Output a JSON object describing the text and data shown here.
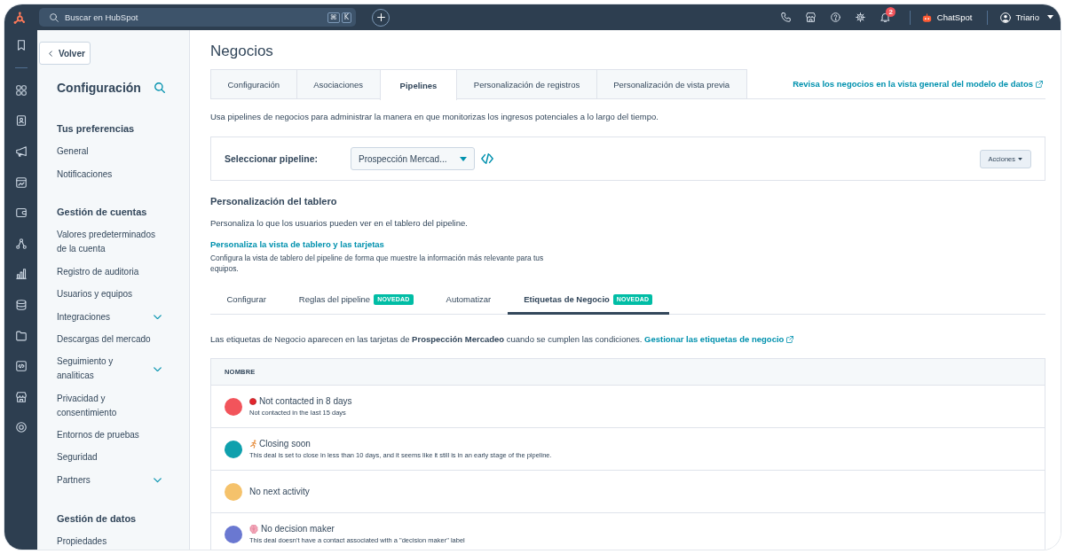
{
  "top_bar": {
    "search": {
      "placeholder": "Buscar en HubSpot",
      "shortcut": [
        "⌘",
        "K"
      ]
    },
    "notifications": {
      "count": "2"
    },
    "assistant": {
      "label": "ChatSpot"
    },
    "account": {
      "name": "Triario"
    }
  },
  "sidebar": {
    "back_button": "Volver",
    "title": "Configuración",
    "sections": [
      {
        "heading": "Tus preferencias",
        "items": [
          {
            "label": "General",
            "kind": "link"
          },
          {
            "label": "Notificaciones",
            "kind": "link"
          }
        ]
      },
      {
        "heading": "Gestión de cuentas",
        "items": [
          {
            "label": "Valores predeterminados de la cuenta",
            "kind": "link"
          },
          {
            "label": "Registro de auditoria",
            "kind": "link"
          },
          {
            "label": "Usuarios y equipos",
            "kind": "link"
          },
          {
            "label": "Integraciones",
            "kind": "group",
            "expanded": false
          },
          {
            "label": "Descargas del mercado",
            "kind": "link"
          },
          {
            "label": "Seguimiento y analiticas",
            "kind": "group",
            "expanded": false
          },
          {
            "label": "Privacidad y consentimiento",
            "kind": "link"
          },
          {
            "label": "Entornos de pruebas",
            "kind": "link"
          },
          {
            "label": "Seguridad",
            "kind": "link"
          },
          {
            "label": "Partners",
            "kind": "group",
            "expanded": false
          }
        ]
      },
      {
        "heading": "Gestión de datos",
        "items": [
          {
            "label": "Propiedades",
            "kind": "link"
          }
        ]
      }
    ]
  },
  "page": {
    "title": "Negocios",
    "tabs": [
      {
        "label": "Configuración",
        "selected": false
      },
      {
        "label": "Asociaciones",
        "selected": false
      },
      {
        "label": "Pipelines",
        "selected": true
      },
      {
        "label": "Personalización de registros",
        "selected": false
      },
      {
        "label": "Personalización de vista previa",
        "selected": false
      }
    ],
    "data_model_link": "Revisa los negocios en la vista general del modelo de datos",
    "description": "Usa pipelines de negocios para administrar la manera en que monitorizas los ingresos potenciales a lo largo del tiempo.",
    "pipeline": {
      "label": "Seleccionar pipeline:",
      "value": "Prospección Mercad...",
      "actions_button": "Acciones"
    },
    "board": {
      "heading": "Personalización del tablero",
      "description": "Personaliza lo que los usuarios pueden ver en el tablero del pipeline.",
      "link": "Personaliza la vista de tablero y las tarjetas",
      "note": "Configura la vista de tablero del pipeline de forma que muestre la información más relevante para tus equipos."
    },
    "sub_tabs": [
      {
        "label": "Configurar",
        "selected": false
      },
      {
        "label": "Reglas del pipeline",
        "badge": "NOVEDAD",
        "selected": false
      },
      {
        "label": "Automatizar",
        "selected": false
      },
      {
        "label": "Etiquetas de Negocio",
        "badge": "NOVEDAD",
        "selected": true
      }
    ],
    "labels_intro": "Las etiquetas de Negocio aparecen en las tarjetas de **Prospección Mercadeo** cuando se cumplen las condiciones.",
    "labels_link": "Gestionar las etiquetas de negocio",
    "table": {
      "columns": [
        "NOMBRE"
      ],
      "rows": [
        {
          "kind": "dot",
          "color": "#f2545b",
          "title": "Not contacted in 8 days",
          "subtitle": "Not contacted in the last 15 days"
        },
        {
          "kind": "runner",
          "color": "#0fa0ad",
          "title": "Closing soon",
          "subtitle": "This deal is set to close in less than 10 days, and it seems like it still is in an early stage of the pipeline."
        },
        {
          "kind": "plain",
          "color": "#f5c26b",
          "title": "No next activity"
        },
        {
          "kind": "brain",
          "color": "#6a78d1",
          "title": "No decision maker",
          "subtitle": "This deal doesn't have a contact associated with a \"decision maker\" label"
        }
      ]
    }
  }
}
